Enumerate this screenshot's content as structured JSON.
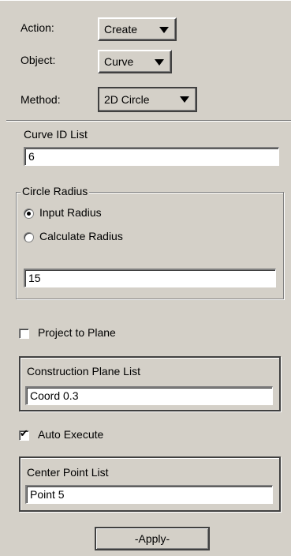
{
  "form": {
    "action": {
      "label": "Action:",
      "value": "Create"
    },
    "object": {
      "label": "Object:",
      "value": "Curve"
    },
    "method": {
      "label": "Method:",
      "value": "2D Circle"
    }
  },
  "curve_id": {
    "label": "Curve ID List",
    "value": "6"
  },
  "circle_radius": {
    "group_label": "Circle Radius",
    "options": [
      {
        "label": "Input Radius",
        "selected": true
      },
      {
        "label": "Calculate Radius",
        "selected": false
      }
    ],
    "value": "15"
  },
  "project_to_plane": {
    "label": "Project to Plane",
    "checked": false
  },
  "construction_plane": {
    "label": "Construction Plane List",
    "value": "Coord 0.3"
  },
  "auto_execute": {
    "label": "Auto Execute",
    "checked": true
  },
  "center_point": {
    "label": "Center Point List",
    "value": "Point 5"
  },
  "apply_button": {
    "label": "-Apply-"
  }
}
